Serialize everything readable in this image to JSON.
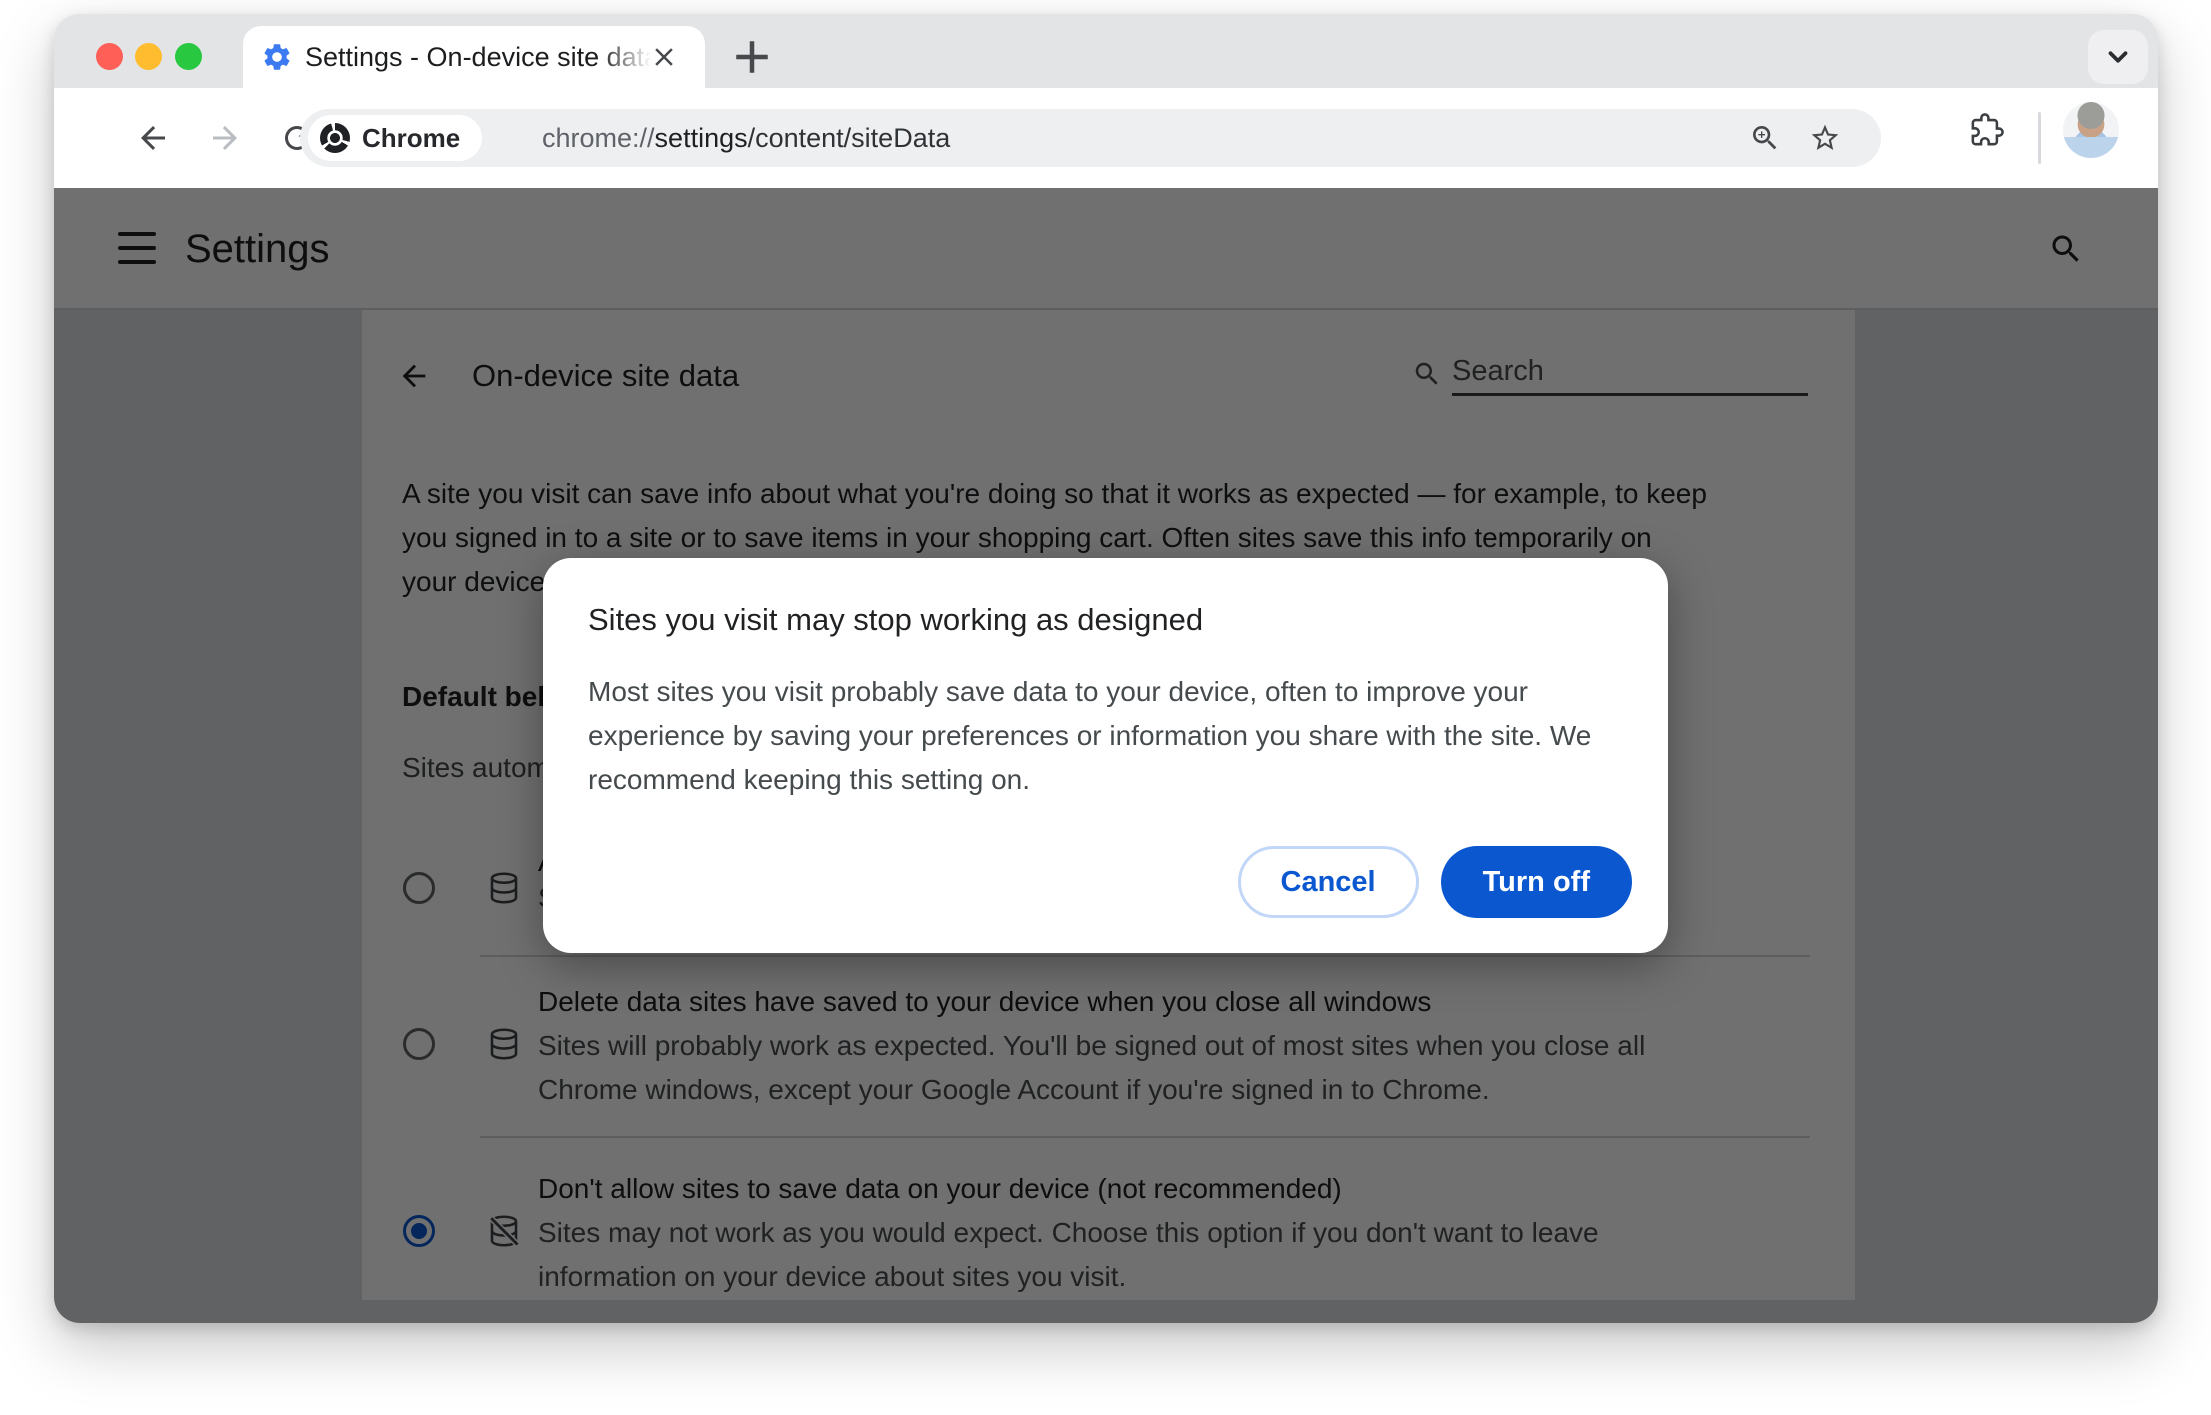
{
  "window": {
    "traffic_lights": {
      "close": "close",
      "minimize": "minimize",
      "zoom": "zoom"
    },
    "tab": {
      "title": "Settings - On-device site data"
    },
    "new_tab_label": "+"
  },
  "toolbar": {
    "chip_label": "Chrome",
    "url_scheme": "chrome://",
    "url_host": "settings",
    "url_path": "/content/siteData"
  },
  "settings": {
    "header_title": "Settings",
    "page_title": "On-device site data",
    "search_placeholder": "Search",
    "intro_lines": [
      "A site you visit can save info about what you're doing so that it works as expected — for example, to keep",
      "you signed in to a site or to save items in your shopping cart. Often sites save this info temporarily on",
      "your device"
    ],
    "default_behavior_label": "Default behavior",
    "default_behavior_sublabel": "Sites automatically follow this setting when you visit them",
    "options": [
      {
        "title": "Allow sites to save data on your device",
        "desc_lines": [
          "Sites will work as expected"
        ],
        "selected": false
      },
      {
        "title": "Delete data sites have saved to your device when you close all windows",
        "desc_lines": [
          "Sites will probably work as expected. You'll be signed out of most sites when you close all",
          "Chrome windows, except your Google Account if you're signed in to Chrome."
        ],
        "selected": false
      },
      {
        "title": "Don't allow sites to save data on your device (not recommended)",
        "desc_lines": [
          "Sites may not work as you would expect. Choose this option if you don't want to leave",
          "information on your device about sites you visit."
        ],
        "selected": true
      }
    ]
  },
  "dialog": {
    "title": "Sites you visit may stop working as designed",
    "body": "Most sites you visit probably save data to your device, often to improve your experience by saving your preferences or information you share with the site. We recommend keeping this setting on.",
    "cancel_label": "Cancel",
    "turn_off_label": "Turn off"
  },
  "colors": {
    "accent_blue": "#0b57d0",
    "traffic_red": "#ff5f57",
    "traffic_yellow": "#febc2e",
    "traffic_green": "#28c840"
  }
}
